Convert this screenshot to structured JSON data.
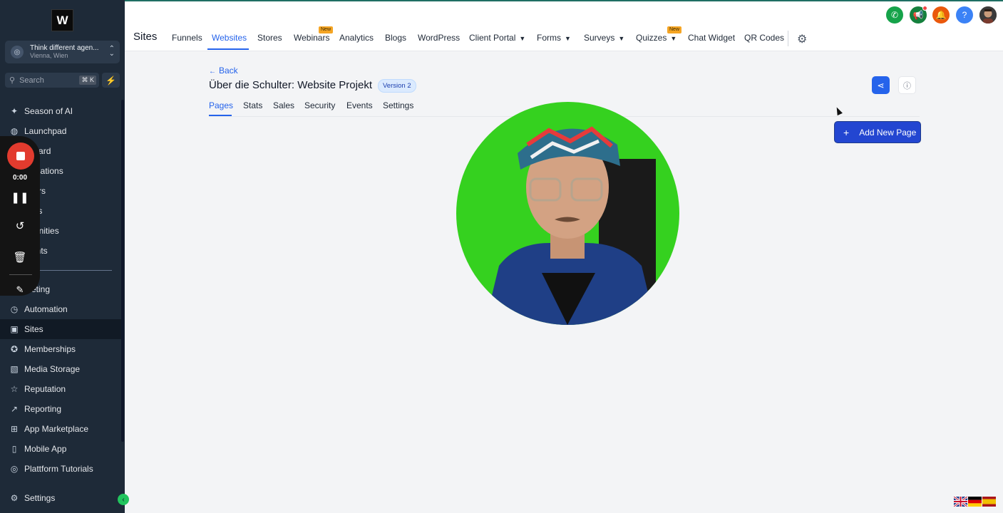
{
  "sidebar": {
    "logo_letter": "W",
    "account": {
      "name": "Think different agen...",
      "location": "Vienna, Wien"
    },
    "search": {
      "placeholder": "Search",
      "shortcut": "⌘ K"
    },
    "items": [
      {
        "label": "Season of AI",
        "icon": "sparkle-icon"
      },
      {
        "label": "Launchpad",
        "icon": "rocket-icon"
      },
      {
        "label": "nboard",
        "icon": "dashboard-icon"
      },
      {
        "label": "versations",
        "icon": "chat-icon"
      },
      {
        "label": "ndars",
        "icon": "calendar-icon"
      },
      {
        "label": "tacts",
        "icon": "contacts-icon"
      },
      {
        "label": "ortunities",
        "icon": "opportunities-icon"
      },
      {
        "label": "ments",
        "icon": "payments-icon"
      },
      {
        "label": "rketing",
        "icon": "marketing-icon"
      },
      {
        "label": "Automation",
        "icon": "automation-icon"
      },
      {
        "label": "Sites",
        "icon": "sites-icon",
        "active": true
      },
      {
        "label": "Memberships",
        "icon": "membership-icon"
      },
      {
        "label": "Media Storage",
        "icon": "image-icon"
      },
      {
        "label": "Reputation",
        "icon": "star-icon"
      },
      {
        "label": "Reporting",
        "icon": "chart-icon"
      },
      {
        "label": "App Marketplace",
        "icon": "grid-icon"
      },
      {
        "label": "Mobile App",
        "icon": "phone-icon"
      },
      {
        "label": "Plattform Tutorials",
        "icon": "tutorial-icon"
      }
    ],
    "settings_label": "Settings"
  },
  "recorder": {
    "time": "0:00"
  },
  "topnav": {
    "section_title": "Sites",
    "tabs": [
      {
        "label": "Funnels"
      },
      {
        "label": "Websites",
        "active": true
      },
      {
        "label": "Stores"
      },
      {
        "label": "Webinars",
        "badge": "New"
      },
      {
        "label": "Analytics"
      },
      {
        "label": "Blogs"
      },
      {
        "label": "WordPress"
      },
      {
        "label": "Client Portal",
        "dropdown": true
      },
      {
        "label": "Forms",
        "dropdown": true
      },
      {
        "label": "Surveys",
        "dropdown": true
      },
      {
        "label": "Quizzes",
        "dropdown": true,
        "badge": "New"
      },
      {
        "label": "Chat Widget"
      },
      {
        "label": "QR Codes"
      }
    ],
    "header_icons": [
      {
        "name": "phone-icon",
        "color": "#16a34a"
      },
      {
        "name": "megaphone-icon",
        "color": "#15803d"
      },
      {
        "name": "bell-icon",
        "color": "#ea580c"
      },
      {
        "name": "help-icon",
        "color": "#3b82f6"
      }
    ]
  },
  "main": {
    "back_label": "Back",
    "title": "Über die Schulter: Website Projekt",
    "version_badge": "Version 2",
    "subtabs": [
      {
        "label": "Pages",
        "active": true
      },
      {
        "label": "Stats"
      },
      {
        "label": "Sales"
      },
      {
        "label": "Security"
      },
      {
        "label": "Events"
      },
      {
        "label": "Settings"
      }
    ],
    "add_page_label": "Add New Page"
  },
  "colors": {
    "accent": "#2563eb",
    "sidebar_bg": "#1e2a38",
    "record_red": "#e23b2e"
  },
  "languages": [
    "English",
    "Deutsch",
    "Español"
  ]
}
